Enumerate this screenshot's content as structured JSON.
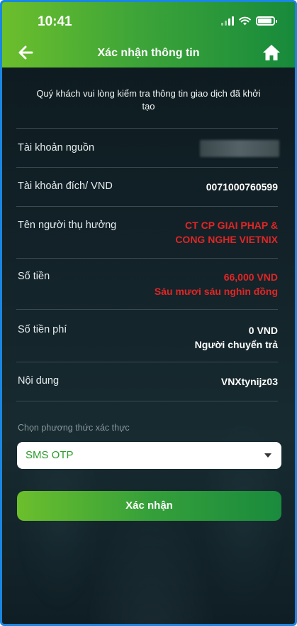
{
  "status_bar": {
    "time": "10:41"
  },
  "header": {
    "title": "Xác nhận thông tin"
  },
  "intro": "Quý khách vui lòng kiểm tra thông tin giao dịch đã khởi tạo",
  "rows": {
    "source_account": {
      "label": "Tài khoản nguồn"
    },
    "dest_account": {
      "label": "Tài khoản đích/ VND",
      "value": "0071000760599"
    },
    "beneficiary": {
      "label": "Tên người thụ hưởng",
      "value_line1": "CT CP GIAI PHAP &",
      "value_line2": "CONG NGHE VIETNIX"
    },
    "amount": {
      "label": "Số tiền",
      "value_line1": "66,000 VND",
      "value_line2": "Sáu mươi sáu nghìn đồng"
    },
    "fee": {
      "label": "Số tiền phí",
      "value_line1": "0 VND",
      "value_line2": "Người chuyển trả"
    },
    "content": {
      "label": "Nội dung",
      "value": "VNXtynijz03"
    }
  },
  "auth": {
    "label": "Chọn phương thức xác thực",
    "selected": "SMS OTP"
  },
  "confirm_button": "Xác nhận",
  "colors": {
    "accent_green": "#3ea538",
    "value_red": "#e02626",
    "background": "#122228"
  }
}
